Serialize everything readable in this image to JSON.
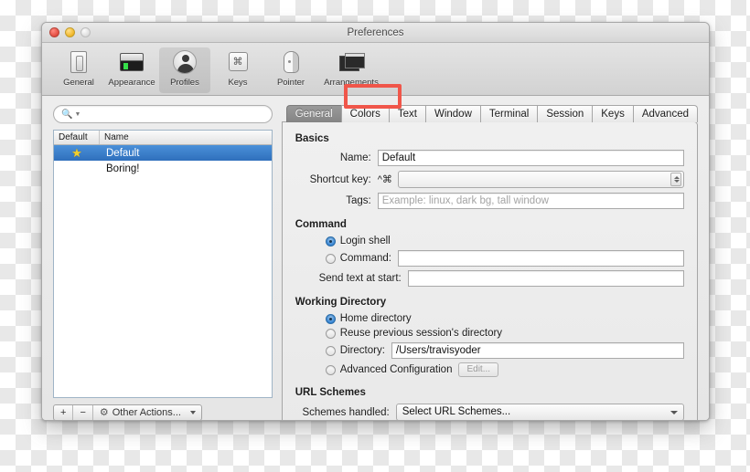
{
  "window": {
    "title": "Preferences",
    "traffic_lights": [
      "close",
      "minimize",
      "zoom"
    ]
  },
  "toolbar": {
    "items": [
      {
        "label": "General",
        "icon": "general-icon"
      },
      {
        "label": "Appearance",
        "icon": "appearance-icon"
      },
      {
        "label": "Profiles",
        "icon": "profiles-icon",
        "selected": true
      },
      {
        "label": "Keys",
        "icon": "keys-icon"
      },
      {
        "label": "Pointer",
        "icon": "pointer-icon"
      },
      {
        "label": "Arrangements",
        "icon": "arrangements-icon"
      }
    ]
  },
  "sidebar": {
    "search": {
      "value": "",
      "placeholder": ""
    },
    "columns": [
      "Default",
      "Name"
    ],
    "rows": [
      {
        "name": "Default",
        "is_default": true,
        "star": "★",
        "selected": true
      },
      {
        "name": "Boring!",
        "is_default": false,
        "star": "",
        "selected": false
      }
    ],
    "actions": {
      "add_label": "+",
      "remove_label": "−",
      "other_actions_label": "Other Actions...",
      "gear_icon": "gear-icon"
    }
  },
  "tabs": [
    {
      "label": "General",
      "active": true
    },
    {
      "label": "Colors",
      "active": false,
      "highlighted": true
    },
    {
      "label": "Text",
      "active": false
    },
    {
      "label": "Window",
      "active": false
    },
    {
      "label": "Terminal",
      "active": false
    },
    {
      "label": "Session",
      "active": false
    },
    {
      "label": "Keys",
      "active": false
    },
    {
      "label": "Advanced",
      "active": false
    }
  ],
  "panel": {
    "basics": {
      "title": "Basics",
      "name_label": "Name:",
      "name_value": "Default",
      "shortcut_label": "Shortcut key:",
      "shortcut_modifiers": "^⌘",
      "shortcut_value": "",
      "tags_label": "Tags:",
      "tags_value": "",
      "tags_placeholder": "Example: linux, dark bg, tall window"
    },
    "command": {
      "title": "Command",
      "login_shell_label": "Login shell",
      "login_shell_selected": true,
      "command_label": "Command:",
      "command_selected": false,
      "command_value": "",
      "send_text_label": "Send text at start:",
      "send_text_value": ""
    },
    "working_directory": {
      "title": "Working Directory",
      "home_label": "Home directory",
      "home_selected": true,
      "reuse_label": "Reuse previous session's directory",
      "reuse_selected": false,
      "directory_label": "Directory:",
      "directory_selected": false,
      "directory_value": "/Users/travisyoder",
      "advanced_label": "Advanced Configuration",
      "advanced_selected": false,
      "edit_button_label": "Edit..."
    },
    "url_schemes": {
      "title": "URL Schemes",
      "schemes_label": "Schemes handled:",
      "schemes_value": "Select URL Schemes..."
    }
  },
  "annotation": {
    "color": "#f0564a",
    "target": "Colors"
  }
}
